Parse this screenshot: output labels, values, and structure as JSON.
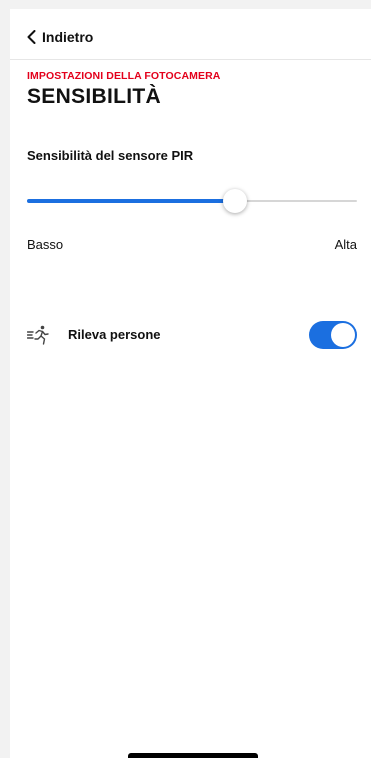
{
  "nav": {
    "back_label": "Indietro",
    "back_icon": "chevron-left-icon"
  },
  "header": {
    "kicker": "IMPOSTAZIONI DELLA FOTOCAMERA",
    "title": "SENSIBILITÀ"
  },
  "pir": {
    "label": "Sensibilità del sensore PIR",
    "value_fraction": 0.63,
    "min_label": "Basso",
    "max_label": "Alta"
  },
  "person_detection": {
    "label": "Rileva persone",
    "enabled": true,
    "icon": "running-person-icon"
  },
  "colors": {
    "accent": "#1b6fe0",
    "kicker": "#e3001b"
  }
}
